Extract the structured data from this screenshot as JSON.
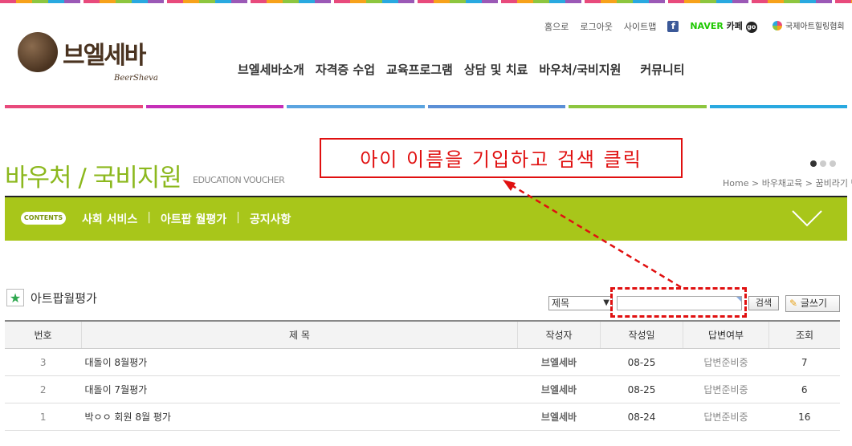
{
  "header": {
    "logo_text": "브엘세바",
    "logo_sub": "BeerSheva",
    "util_links": [
      "홈으로",
      "로그아웃",
      "사이트맵"
    ],
    "naver_label_a": "NAVER",
    "naver_label_b": "카페",
    "assoc_label": "국제아트힐링협회",
    "gnb": [
      "브엘세바소개",
      "자격증 수업",
      "교육프로그램",
      "상담 및 치료",
      "바우처/국비지원",
      "커뮤니티"
    ],
    "colorbar": [
      "#e84a7c",
      "#c52fb8",
      "#5ba4e0",
      "#5b8fd6",
      "#8dc63f",
      "#29a9e0"
    ]
  },
  "page": {
    "title": "바우처 / 국비지원",
    "subtitle": "EDUCATION VOUCHER",
    "breadcrumb": "Home > 바우채교육 > 꿈비라기 반",
    "contents_badge": "CONTENTS",
    "submenu": [
      "사회 서비스",
      "아트팝 월평가",
      "공지사항"
    ]
  },
  "annotation": {
    "text": "아이 이름을 기입하고 검색 클릭",
    "color": "#e01010"
  },
  "board": {
    "title": "아트팝월평가",
    "search_select": "제목",
    "search_value": "",
    "search_button": "검색",
    "write_button": "글쓰기",
    "columns": [
      "번호",
      "제    목",
      "작성자",
      "작성일",
      "답변여부",
      "조회"
    ],
    "rows": [
      {
        "no": "3",
        "title": "대돌이 8월평가",
        "author": "브엘세바",
        "date": "08-25",
        "status": "답변준비중",
        "views": "7"
      },
      {
        "no": "2",
        "title": "대돌이 7월평가",
        "author": "브엘세바",
        "date": "08-25",
        "status": "답변준비중",
        "views": "6"
      },
      {
        "no": "1",
        "title": "박ㅇㅇ 회원 8월 평가",
        "author": "브엘세바",
        "date": "08-24",
        "status": "답변준비중",
        "views": "16"
      }
    ]
  },
  "colors": {
    "accent_green": "#8cb81e",
    "subbar": "#a8c61a"
  }
}
